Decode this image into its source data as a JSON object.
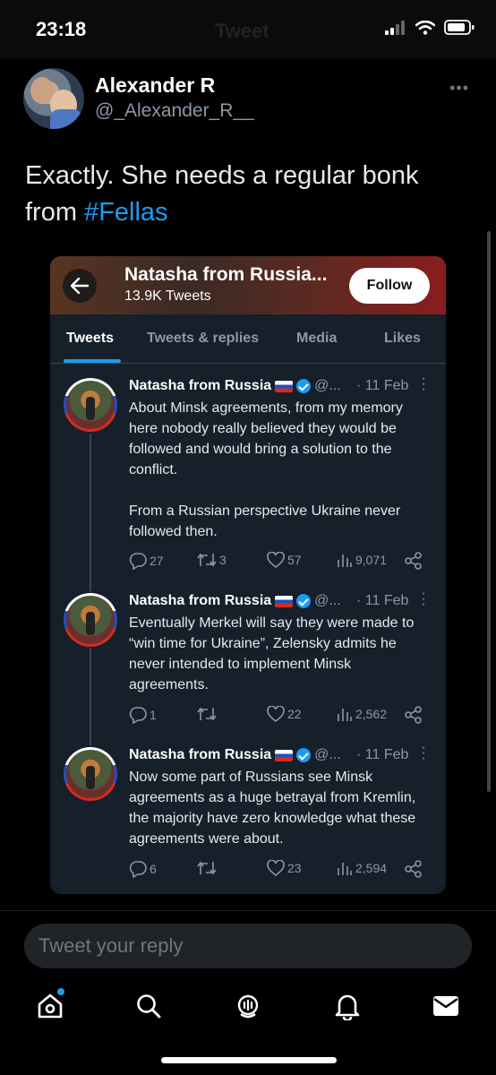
{
  "status_bar": {
    "time": "23:18",
    "ghost_title": "Tweet"
  },
  "post": {
    "display_name": "Alexander R",
    "handle": "@_Alexander_R__",
    "text_before": "Exactly.  She needs a regular bonk from ",
    "hashtag": "#Fellas"
  },
  "embedded": {
    "profile_name": "Natasha from Russia...",
    "tweet_count": "13.9K Tweets",
    "follow_label": "Follow",
    "tabs": [
      "Tweets",
      "Tweets & replies",
      "Media",
      "Likes"
    ],
    "tweets": [
      {
        "name": "Natasha from Russia",
        "handle": "@...",
        "date": "· 11 Feb",
        "text": "About Minsk agreements, from my memory here nobody really believed they would be followed and would bring a solution to the conflict.\n\nFrom a Russian perspective Ukraine never followed then.",
        "replies": "27",
        "retweets": "3",
        "likes": "57",
        "views": "9,071"
      },
      {
        "name": "Natasha from Russia",
        "handle": "@...",
        "date": "· 11 Feb",
        "text": "Eventually Merkel will say they were made to “win time for Ukraine”, Zelensky admits he never intended to implement Minsk agreements.",
        "replies": "1",
        "retweets": "",
        "likes": "22",
        "views": "2,562"
      },
      {
        "name": "Natasha from Russia",
        "handle": "@...",
        "date": "· 11 Feb",
        "text": "Now some part of Russians see Minsk agreements as a huge betrayal from Kremlin, the majority have zero knowledge what these agreements were about.",
        "replies": "6",
        "retweets": "",
        "likes": "23",
        "views": "2,594"
      }
    ]
  },
  "reply": {
    "placeholder": "Tweet your reply"
  },
  "colors": {
    "accent": "#1d9bf0",
    "card_bg": "#15202b",
    "muted": "#8b98a5"
  }
}
